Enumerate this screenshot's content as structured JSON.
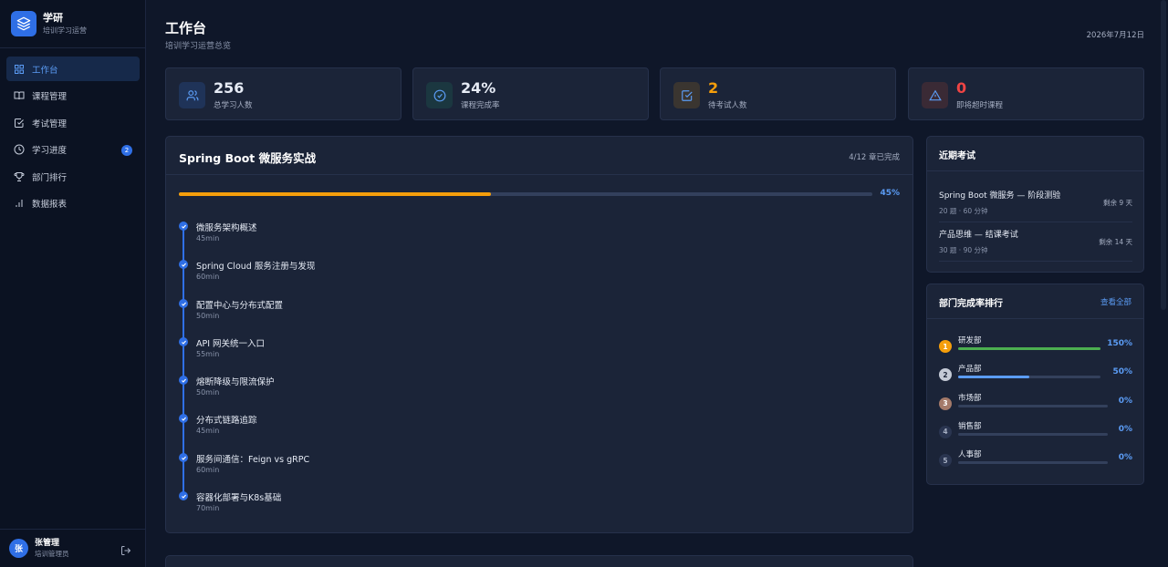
{
  "brand": {
    "name": "学研",
    "subtitle": "培训学习运营"
  },
  "nav": [
    {
      "label": "工作台",
      "icon": "dashboard-icon",
      "active": true
    },
    {
      "label": "课程管理",
      "icon": "book-icon"
    },
    {
      "label": "考试管理",
      "icon": "checklist-icon"
    },
    {
      "label": "学习进度",
      "icon": "clock-icon",
      "badge": "2"
    },
    {
      "label": "部门排行",
      "icon": "trophy-icon"
    },
    {
      "label": "数据报表",
      "icon": "bar-chart-icon"
    }
  ],
  "user": {
    "avatar": "张",
    "name": "张管理",
    "role": "培训管理员"
  },
  "header": {
    "title": "工作台",
    "subtitle": "培训学习运营总览",
    "date": "2026年7月12日"
  },
  "stats": [
    {
      "value": "256",
      "label": "总学习人数",
      "color": "#ffffff",
      "icon": "users-icon"
    },
    {
      "value": "24%",
      "label": "课程完成率",
      "color": "#ffffff",
      "icon": "check-circle-icon"
    },
    {
      "value": "2",
      "label": "待考试人数",
      "color": "#f59e0b",
      "icon": "check-square-icon"
    },
    {
      "value": "0",
      "label": "即将超时课程",
      "color": "#ef4444",
      "icon": "warning-icon"
    }
  ],
  "course": {
    "title": "Spring Boot 微服务实战",
    "meta": "4/12 章已完成",
    "progress": 45,
    "progress_label": "45%",
    "lessons": [
      {
        "name": "微服务架构概述",
        "duration": "45min"
      },
      {
        "name": "Spring Cloud 服务注册与发现",
        "duration": "60min"
      },
      {
        "name": "配置中心与分布式配置",
        "duration": "50min"
      },
      {
        "name": "API 网关统一入口",
        "duration": "55min"
      },
      {
        "name": "熔断降级与限流保护",
        "duration": "50min"
      },
      {
        "name": "分布式链路追踪",
        "duration": "45min"
      },
      {
        "name": "服务间通信：Feign vs gRPC",
        "duration": "60min"
      },
      {
        "name": "容器化部署与K8s基础",
        "duration": "70min"
      }
    ]
  },
  "exams": {
    "title": "近期考试",
    "items": [
      {
        "name": "Spring Boot 微服务 — 阶段测验",
        "meta": "20 题 · 60 分钟",
        "remain": "剩余 9 天"
      },
      {
        "name": "产品思维 — 结课考试",
        "meta": "30 题 · 90 分钟",
        "remain": "剩余 14 天"
      }
    ]
  },
  "ranking": {
    "title": "部门完成率排行",
    "link": "查看全部",
    "items": [
      {
        "rank": "1",
        "name": "研发部",
        "pct_label": "150%",
        "fill": 1.0,
        "bar_color": "#4caf50",
        "badge_bg": "#f59e0b",
        "badge_fg": "#ffffff"
      },
      {
        "rank": "2",
        "name": "产品部",
        "pct_label": "50%",
        "fill": 0.5,
        "bar_color": "#5b9cf5",
        "badge_bg": "#c4cad6",
        "badge_fg": "#1b2438"
      },
      {
        "rank": "3",
        "name": "市场部",
        "pct_label": "0%",
        "fill": 0,
        "bar_color": "#5b9cf5",
        "badge_bg": "#a47a6a",
        "badge_fg": "#ffffff"
      },
      {
        "rank": "4",
        "name": "销售部",
        "pct_label": "0%",
        "fill": 0,
        "bar_color": "#5b9cf5",
        "badge_bg": "#2a3550",
        "badge_fg": "#a5aec2"
      },
      {
        "rank": "5",
        "name": "人事部",
        "pct_label": "0%",
        "fill": 0,
        "bar_color": "#5b9cf5",
        "badge_bg": "#2a3550",
        "badge_fg": "#a5aec2"
      }
    ]
  }
}
